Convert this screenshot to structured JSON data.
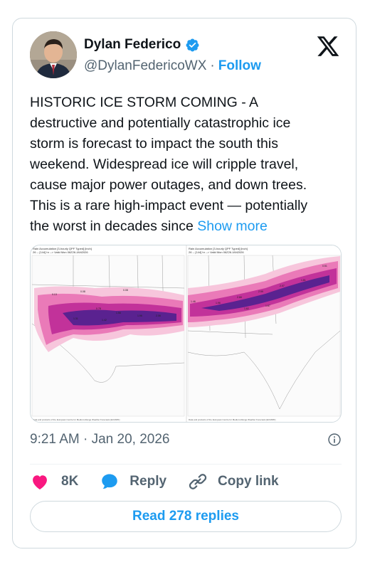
{
  "author": {
    "display_name": "Dylan Federico",
    "handle": "@DylanFedericoWX",
    "separator": "·",
    "follow_label": "Follow"
  },
  "tweet": {
    "text": "HISTORIC ICE STORM COMING - A\ndestructive and potentially catastrophic ice\nstorm is forecast to impact the south this\nweekend. Widespread ice will cripple travel,\ncause major power outages, and down trees.\nThis is a rare high-impact event — potentially\nthe worst in decades since ",
    "show_more_label": "Show more",
    "timestamp": "9:21 AM · Jan 20, 2026"
  },
  "media": {
    "left_panel": {
      "title_line1": "Rain Accumulation [3-hourly QPF Typed] [inch]",
      "title_line2": "26 -- [144] hr --> Valid Mon 06Z26.JAN2026",
      "footer": "Data and products of the European Centre for Medium-Range Weather Forecasts (ECMWF)"
    },
    "right_panel": {
      "title_line1": "Rain Accumulation [3-hourly QPF Typed] [inch]",
      "title_line2": "26 -- [144] hr --> Valid Mon 06Z26.JAN2026",
      "footer": "Data and products of the European Centre for Medium-Range Weather Forecasts (ECMWF)"
    }
  },
  "actions": {
    "like_count": "8K",
    "reply_label": "Reply",
    "copy_link_label": "Copy link",
    "read_replies_label": "Read 278 replies"
  },
  "colors": {
    "accent": "#1d9bf0",
    "like": "#f91880",
    "text_primary": "#0f1419",
    "text_secondary": "#536471",
    "border": "#cfd9de",
    "ice_light": "#f3a6c8",
    "ice_mid": "#d63c9a",
    "ice_heavy": "#4a1a80"
  },
  "icons": {
    "verified": "verified-badge-icon",
    "platform": "x-logo-icon",
    "info": "info-icon",
    "like": "heart-icon",
    "reply": "speech-bubble-icon",
    "copy_link": "link-icon"
  }
}
